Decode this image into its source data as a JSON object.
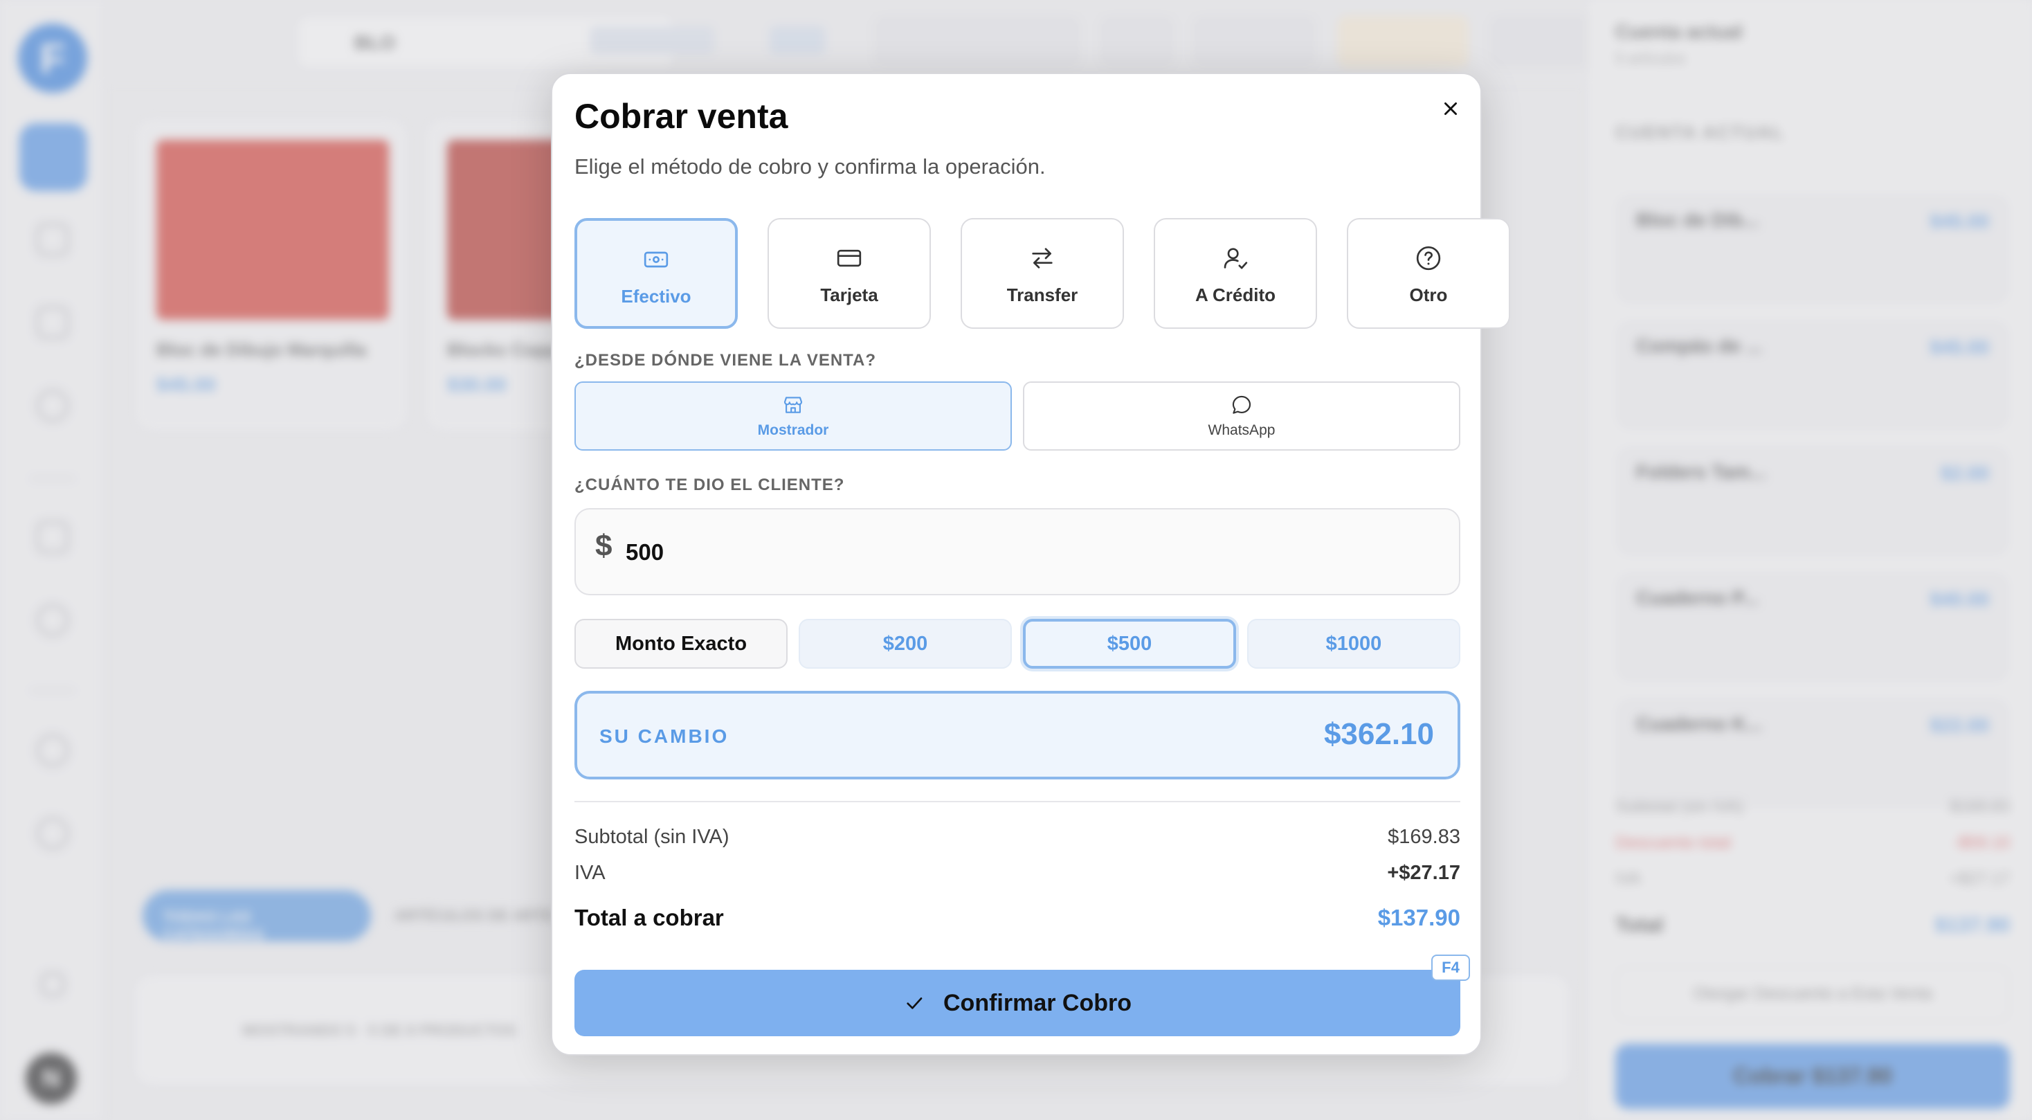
{
  "modal": {
    "title": "Cobrar venta",
    "subtitle": "Elige el método de cobro y confirma la operación.",
    "close_icon": "close-icon",
    "methods": [
      {
        "label": "Efectivo",
        "icon": "cash-icon",
        "active": true
      },
      {
        "label": "Tarjeta",
        "icon": "card-icon",
        "active": false
      },
      {
        "label": "Transfer",
        "icon": "transfer-icon",
        "active": false
      },
      {
        "label": "A Crédito",
        "icon": "user-check-icon",
        "active": false
      },
      {
        "label": "Otro",
        "icon": "help-circle-icon",
        "active": false
      }
    ],
    "origin_label": "¿DESDE DÓNDE VIENE LA VENTA?",
    "origins": [
      {
        "label": "Mostrador",
        "icon": "store-icon",
        "active": true
      },
      {
        "label": "WhatsApp",
        "icon": "chat-icon",
        "active": false
      }
    ],
    "amount_label": "¿CUÁNTO TE DIO EL CLIENTE?",
    "currency_symbol": "$",
    "amount_value": "500",
    "quick_amounts": [
      {
        "label": "Monto Exacto"
      },
      {
        "label": "$200"
      },
      {
        "label": "$500",
        "selected": true
      },
      {
        "label": "$1000"
      }
    ],
    "change_label": "SU CAMBIO",
    "change_value": "$362.10",
    "subtotal_label": "Subtotal (sin IVA)",
    "subtotal_value": "$169.83",
    "iva_label": "IVA",
    "iva_value": "+$27.17",
    "total_label": "Total a cobrar",
    "total_value": "$137.90",
    "confirm_label": "Confirmar Cobro",
    "confirm_shortcut": "F4"
  },
  "background": {
    "logo_letter": "F",
    "user_initial": "N",
    "search_value": "BLO",
    "products": [
      {
        "name": "Bloc de Dibujo Marquilla",
        "price": "$45.00"
      },
      {
        "name": "Blocks Copp",
        "price": "$30.00"
      }
    ],
    "category_active": "TODAS LAS CATEGORÍAS",
    "category_other": "ARTÍCULOS DE ARTE",
    "bottom_text": "MOSTRANDO 5 · 5 DE 8 PRODUCTOS",
    "cart": {
      "title": "Cuenta actual",
      "subtitle": "5 artículos",
      "header": "CUENTA ACTUAL",
      "items": [
        {
          "name": "Bloc de Dib...",
          "price": "$45.00"
        },
        {
          "name": "Compás de ...",
          "price": "$45.00"
        },
        {
          "name": "Folders Tam...",
          "price": "$2.00"
        },
        {
          "name": "Cuaderno P...",
          "price": "$40.00"
        },
        {
          "name": "Cuaderno K...",
          "price": "$22.00"
        }
      ],
      "subtotal_label": "Subtotal (sin IVA)",
      "subtotal_value": "$169.83",
      "discount_label": "Descuento total",
      "discount_value": "-$59.10",
      "iva_label": "IVA",
      "iva_value": "+$27.17",
      "total_label": "Total",
      "total_value": "$137.90",
      "discount_button": "Otorgar Descuento a Esta Venta",
      "charge_button": "Cobrar $137.90"
    }
  },
  "colors": {
    "accent": "#5a9be6",
    "accent_border": "#8bb8ec",
    "accent_bg": "#eef5fd",
    "confirm_bg": "#7eb0ef"
  }
}
